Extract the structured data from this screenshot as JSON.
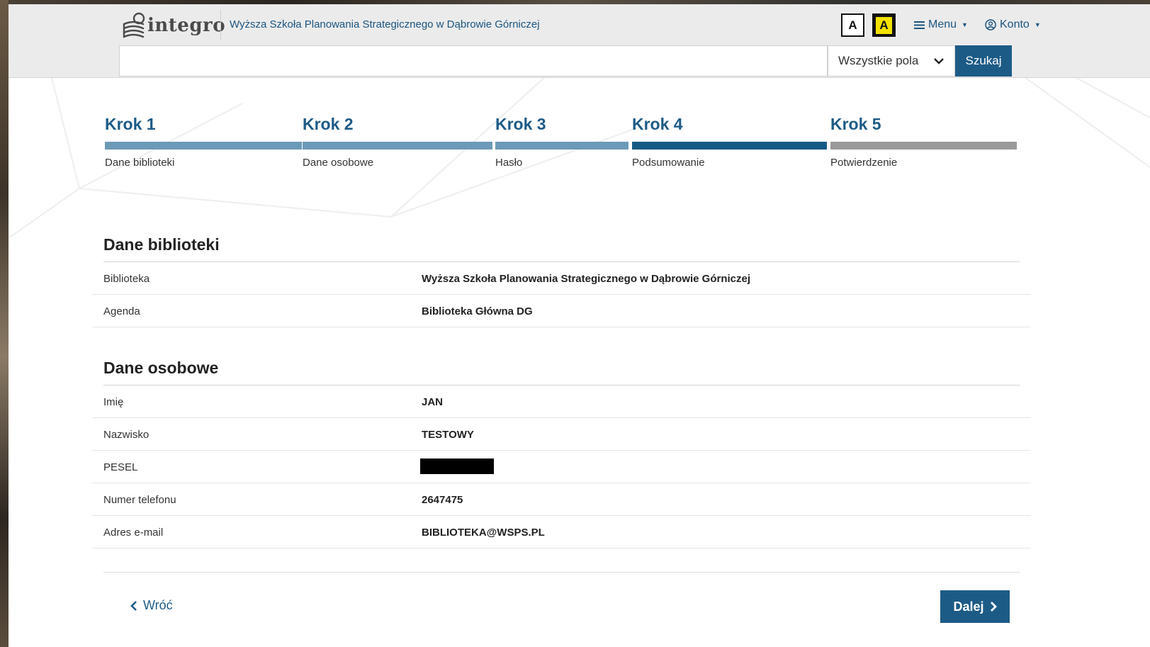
{
  "header": {
    "logo_text": "integro",
    "library_name": "Wyższa Szkoła Planowania Strategicznego w Dąbrowie Górniczej",
    "contrast_normal_label": "A",
    "contrast_high_label": "A",
    "menu_label": "Menu",
    "account_label": "Konto"
  },
  "search": {
    "value": "",
    "field_selected": "Wszystkie pola",
    "button_label": "Szukaj"
  },
  "steps": [
    {
      "title": "Krok 1",
      "subtitle": "Dane biblioteki",
      "state": "done"
    },
    {
      "title": "Krok 2",
      "subtitle": "Dane osobowe",
      "state": "done"
    },
    {
      "title": "Krok 3",
      "subtitle": "Hasło",
      "state": "done"
    },
    {
      "title": "Krok 4",
      "subtitle": "Podsumowanie",
      "state": "active"
    },
    {
      "title": "Krok 5",
      "subtitle": "Potwierdzenie",
      "state": "todo"
    }
  ],
  "library_section": {
    "title": "Dane biblioteki",
    "rows": [
      {
        "label": "Biblioteka",
        "value": "Wyższa Szkoła Planowania Strategicznego w Dąbrowie Górniczej"
      },
      {
        "label": "Agenda",
        "value": "Biblioteka Główna DG"
      }
    ]
  },
  "personal_section": {
    "title": "Dane osobowe",
    "rows": [
      {
        "label": "Imię",
        "value": "JAN"
      },
      {
        "label": "Nazwisko",
        "value": "TESTOWY"
      },
      {
        "label": "PESEL",
        "value": ""
      },
      {
        "label": "Numer telefonu",
        "value": "2647475"
      },
      {
        "label": "Adres e-mail",
        "value": "BIBLIOTEKA@WSPS.PL"
      }
    ]
  },
  "nav": {
    "back_label": "Wróć",
    "next_label": "Dalej"
  },
  "colors": {
    "primary": "#1d5b87",
    "step_done": "#6b9ab7",
    "step_active": "#155a85",
    "step_todo": "#9a9a9a",
    "header_bg": "#ebebeb"
  }
}
